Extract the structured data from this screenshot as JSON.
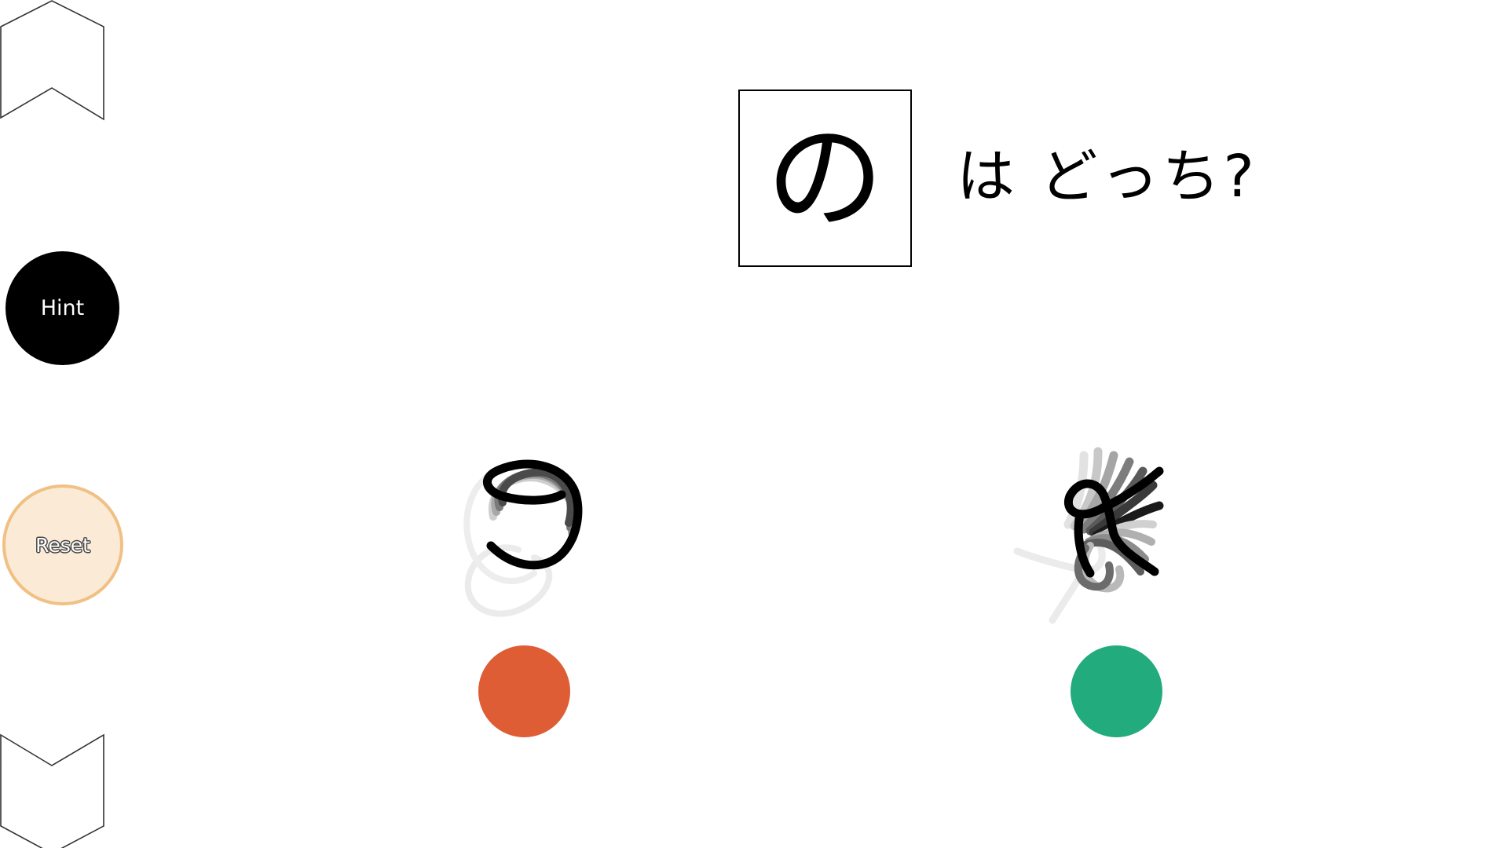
{
  "navigation": {
    "up_icon": "chevron-up-icon",
    "down_icon": "chevron-down-icon"
  },
  "sidebar": {
    "hint_label": "Hint",
    "reset_label": "Reset"
  },
  "prompt": {
    "character": "の",
    "question": "は どっち?"
  },
  "choices": [
    {
      "name": "choice-left",
      "animation": "stroke-order-animation",
      "color": "#de5d35"
    },
    {
      "name": "choice-right",
      "animation": "stroke-order-animation",
      "color": "#22ab7c"
    }
  ],
  "colors": {
    "hint_bg": "#000000",
    "reset_bg": "#fbead6",
    "reset_border": "#f0c084",
    "choice_left": "#de5d35",
    "choice_right": "#22ab7c"
  }
}
